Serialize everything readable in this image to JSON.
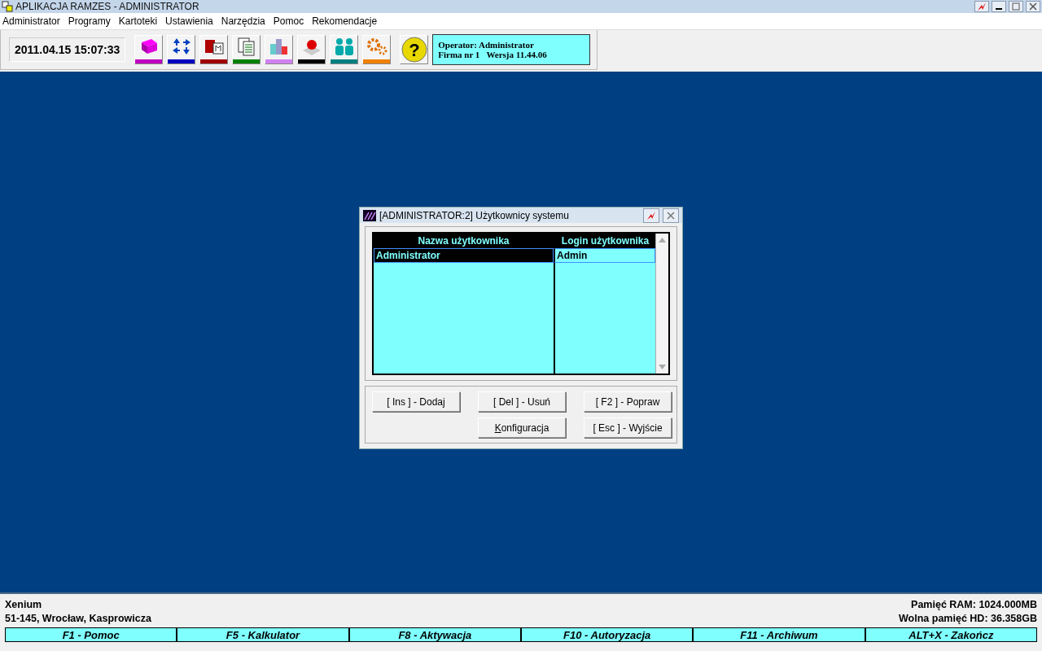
{
  "window": {
    "title": "APLIKACJA RAMZES - ADMINISTRATOR"
  },
  "menu": [
    "Administrator",
    "Programy",
    "Kartoteki",
    "Ustawienia",
    "Narzędzia",
    "Pomoc",
    "Rekomendacje"
  ],
  "toolbar": {
    "clock": "2011.04.15 15:07:33",
    "tools": [
      {
        "kind": "books",
        "color": "#c000c0"
      },
      {
        "kind": "arrows",
        "color": "#0000c0"
      },
      {
        "kind": "cards",
        "color": "#a00000"
      },
      {
        "kind": "docs",
        "color": "#008000"
      },
      {
        "kind": "chart",
        "color": "#d080f0"
      },
      {
        "kind": "ball",
        "color": "#000000"
      },
      {
        "kind": "people",
        "color": "#008080"
      },
      {
        "kind": "gears",
        "color": "#f08000"
      }
    ],
    "help_glyph": "?",
    "info": [
      "Operator: Administrator",
      "Firma nr 1   Wersja 11.44.06"
    ]
  },
  "dialog": {
    "title": "[ADMINISTRATOR:2]  Użytkownicy systemu",
    "columns": [
      "Nazwa użytkownika",
      "Login użytkownika"
    ],
    "rows": [
      {
        "cells": [
          "Administrator",
          "Admin"
        ],
        "selected": true
      }
    ],
    "buttons": [
      {
        "label": "[ Ins ] - Dodaj"
      },
      {
        "label": "[ Del ] - Usuń"
      },
      {
        "label": "[ F2 ] - Popraw"
      },
      {
        "hotkey": "K",
        "label": "onfiguracja"
      },
      {
        "label": "[ Esc ] - Wyjście"
      }
    ]
  },
  "footer": {
    "company": [
      "Xenium",
      "51-145, Wrocław, Kasprowicza"
    ],
    "system": [
      "Pamięć RAM: 1024.000MB",
      "Wolna pamięć HD: 36.358GB"
    ],
    "keys": [
      "F1 - Pomoc",
      "F5 - Kalkulator",
      "F8 - Aktywacja",
      "F10 - Autoryzacja",
      "F11 - Archiwum",
      "ALT+X - Zakończ"
    ]
  }
}
